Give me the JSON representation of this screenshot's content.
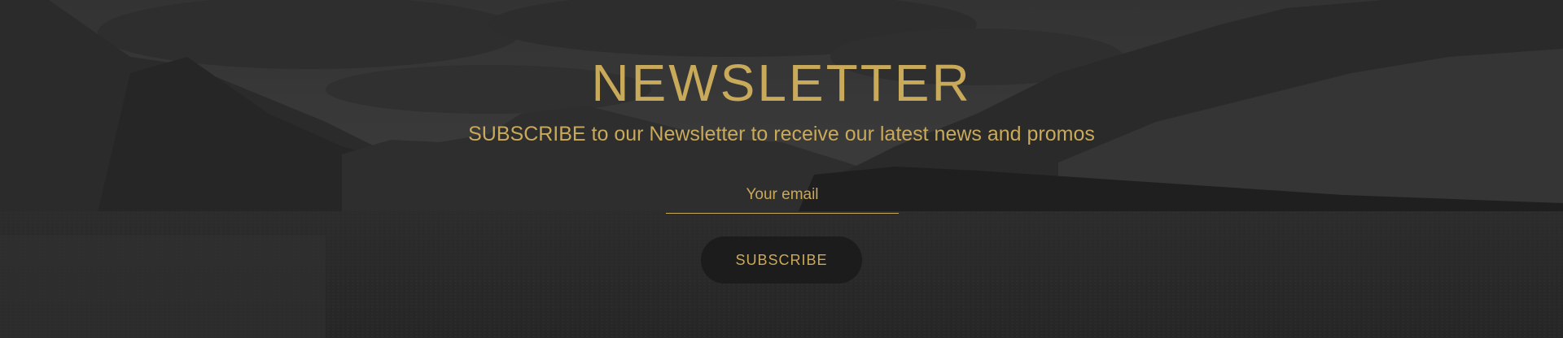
{
  "newsletter": {
    "title": "NEWSLETTER",
    "subtitle": "SUBSCRIBE to our Newsletter to receive our latest news and promos",
    "email_placeholder": "Your email",
    "email_value": "",
    "subscribe_label": "SUBSCRIBE"
  },
  "colors": {
    "accent_gold": "#c9a95a",
    "button_bg": "#1c1c1c",
    "overlay_dark": "#2a2a2a"
  },
  "background": {
    "icon": "mountain-lake-photo"
  }
}
